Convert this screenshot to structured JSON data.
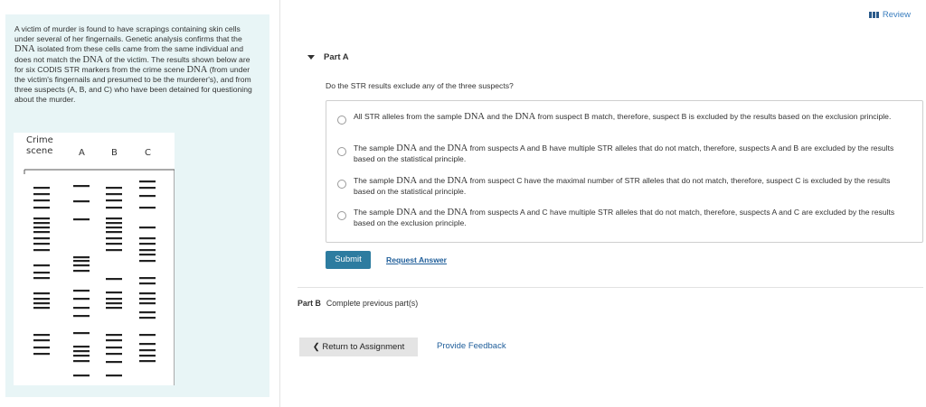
{
  "header": {
    "review_label": "Review"
  },
  "problem": {
    "intro_parts": [
      "A victim of murder is found to have scrapings containing skin cells under several of her fingernails. Genetic analysis confirms that the ",
      "DNA",
      " isolated from these cells came from the same individual and does not match the ",
      "DNA",
      " of the victim. The results shown below are for six CODIS STR markers from the crime scene ",
      "DNA",
      " (from under the victim's fingernails and presumed to be the murderer's), and from three suspects (A, B, and C) who have been detained for questioning about the murder."
    ],
    "gel": {
      "lane_labels": [
        "Crime\nscene",
        "A",
        "B",
        "C"
      ]
    }
  },
  "part_a": {
    "label": "Part A",
    "question": "Do the STR results exclude any of the three suspects?",
    "options": [
      {
        "pre": "All STR alleles from the sample ",
        "dna1": "DNA",
        "mid": " and the ",
        "dna2": "DNA",
        "post": " from suspect B match, therefore, suspect B is excluded by the results based on the exclusion principle."
      },
      {
        "pre": "The sample ",
        "dna1": "DNA",
        "mid": " and the ",
        "dna2": "DNA",
        "post": " from suspects A and B have multiple STR alleles that do not match, therefore, suspects A and B are excluded by the results based on the statistical principle."
      },
      {
        "pre": "The sample ",
        "dna1": "DNA",
        "mid": " and the ",
        "dna2": "DNA",
        "post": " from suspect C have the maximal number of STR alleles that do not match, therefore, suspect C is excluded by the results based on the statistical principle."
      },
      {
        "pre": "The sample ",
        "dna1": "DNA",
        "mid": " and the ",
        "dna2": "DNA",
        "post": " from suspects A and C have multiple STR alleles that do not match, therefore, suspects A and C are excluded by the results based on the exclusion principle."
      }
    ],
    "submit_label": "Submit",
    "request_answer_label": "Request Answer"
  },
  "part_b": {
    "label": "Part B",
    "text": "Complete previous part(s)"
  },
  "footer": {
    "return_label": "Return to Assignment",
    "feedback_label": "Provide Feedback"
  }
}
